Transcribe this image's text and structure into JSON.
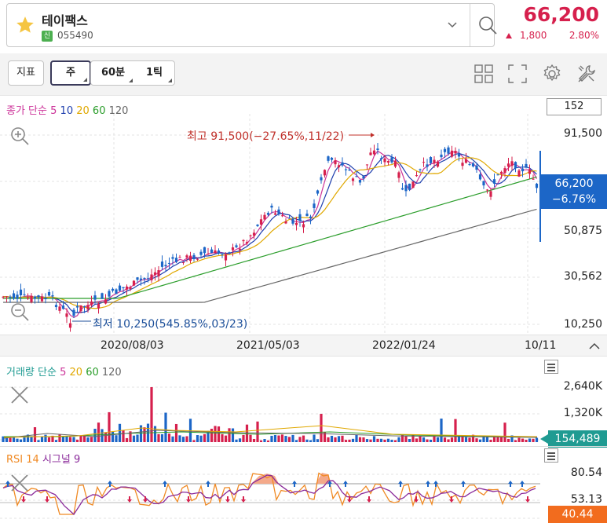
{
  "header": {
    "stock_name": "테이팩스",
    "badge": "신",
    "code": "055490",
    "price": "66,200",
    "change": "1,800",
    "change_pct": "2.80%",
    "colors": {
      "up": "#d6204d",
      "down": "#1c66c7"
    }
  },
  "toolbar": {
    "indicator_label": "지표",
    "period_week": "주",
    "period_60min": "60분",
    "period_1tick": "1틱",
    "icons": [
      "grid-icon",
      "fullscreen-icon",
      "settings-icon",
      "tools-icon"
    ]
  },
  "price_chart": {
    "legend_prefix": "종가 단순",
    "ma": [
      {
        "label": "5",
        "color": "#cc3399"
      },
      {
        "label": "10",
        "color": "#1f3fae"
      },
      {
        "label": "20",
        "color": "#e0a800"
      },
      {
        "label": "60",
        "color": "#2a9d2a"
      },
      {
        "label": "120",
        "color": "#666666"
      }
    ],
    "count_box": "152",
    "y_labels": [
      "91,500",
      "50,875",
      "30,562",
      "10,250"
    ],
    "current_price": "66,200",
    "current_change": "−6.76%",
    "high_annotation": "최고 91,500(−27.65%,11/22)",
    "low_annotation": "최저 10,250(545.85%,03/23)",
    "dates": [
      "2020/08/03",
      "2021/05/03",
      "2022/01/24",
      "10/11"
    ]
  },
  "volume_chart": {
    "legend_prefix": "거래량 단순",
    "ma": [
      {
        "label": "5",
        "color": "#cc3399"
      },
      {
        "label": "20",
        "color": "#e0a800"
      },
      {
        "label": "60",
        "color": "#2a9d2a"
      },
      {
        "label": "120",
        "color": "#666666"
      }
    ],
    "y_labels": [
      "2,640K",
      "1,320K"
    ],
    "current_volume": "154,489"
  },
  "rsi_chart": {
    "legend_rsi": "RSI 14",
    "legend_signal": "시그널 9",
    "y_labels": [
      "80.54",
      "53.13"
    ],
    "current_value": "40.44",
    "colors": {
      "rsi": "#f08a24",
      "signal": "#8a2a9a"
    }
  }
}
